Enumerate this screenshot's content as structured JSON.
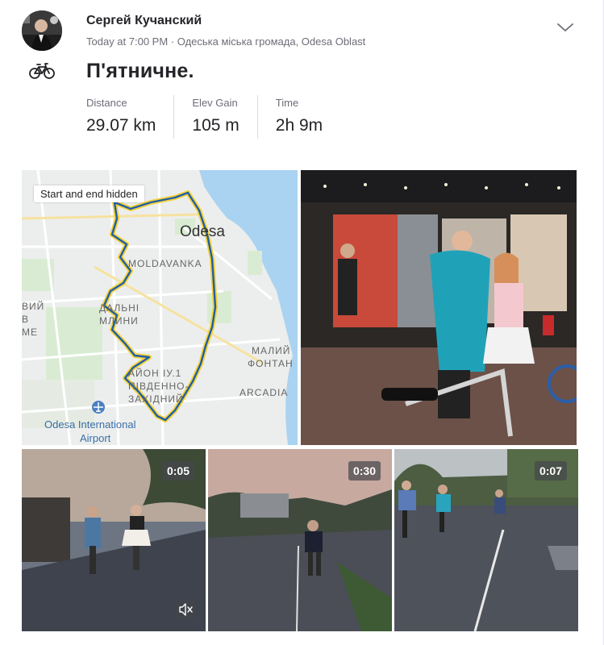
{
  "activity": {
    "athlete_name": "Сергей Кучанский",
    "timestamp": "Today at 7:00 PM",
    "location": "Одеська міська громада, Odesa Oblast",
    "title": "П'ятничне.",
    "sport_icon": "bicycle-icon",
    "menu_icon": "chevron-down-icon"
  },
  "stats": [
    {
      "label": "Distance",
      "value": "29.07 km"
    },
    {
      "label": "Elev Gain",
      "value": "105 m"
    },
    {
      "label": "Time",
      "value": "2h 9m"
    }
  ],
  "map": {
    "notice": "Start and end hidden",
    "labels": {
      "city": "Odesa",
      "district1": "MOLDAVANKA",
      "district2a": "ДАЛЬНІ",
      "district2b": "МЛИНИ",
      "district3a": "ВИЙ",
      "district3b": "В",
      "district3c": "МЕ",
      "district4a": "МАЛИЙ",
      "district4b": "ФОНТАН",
      "district5a": "АЙОН ІУ.1",
      "district5b": "ПІВДЕННО-",
      "district5c": "ЗАХІДНИЙ",
      "district6": "ARCADIA",
      "airport1": "Odesa International",
      "airport2": "Airport"
    },
    "route_color": "#1f5fa6",
    "route_highlight": "#f3d13a"
  },
  "media": {
    "videos": [
      {
        "duration": "0:05",
        "muted_icon": "mute-icon"
      },
      {
        "duration": "0:30"
      },
      {
        "duration": "0:07"
      }
    ]
  }
}
